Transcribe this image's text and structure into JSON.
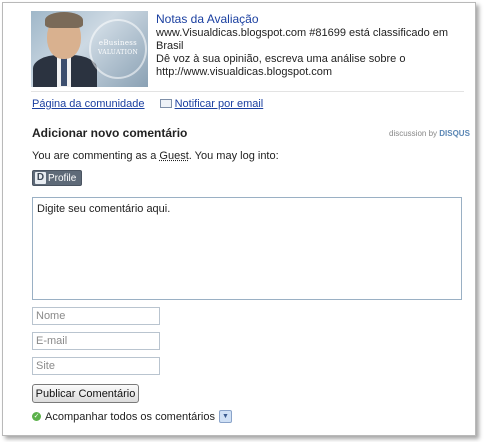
{
  "header": {
    "title": "Notas da Avaliação",
    "seal_text_line1": "eBusiness",
    "seal_text_line2": "Valuation",
    "description_line1": "www.Visualdicas.blogspot.com #81699 está classificado em",
    "description_line2": "Brasil",
    "description_line3": "Dê voz à sua opinião, escreva uma análise sobre o",
    "description_line4": "http://www.visualdicas.blogspot.com"
  },
  "links": {
    "community": "Página da comunidade",
    "notify_email": "Notificar por email"
  },
  "comments": {
    "section_title": "Adicionar novo comentário",
    "powered_prefix": "discussion by ",
    "powered_brand": "DISQUS",
    "commenting_prefix": "You are commenting as a ",
    "commenting_user": "Guest",
    "commenting_suffix": ". You may log into:",
    "profile_label": "Profile",
    "profile_mark": "D",
    "textarea_placeholder": "Digite seu comentário aqui.",
    "name_placeholder": "Nome",
    "email_placeholder": "E-mail",
    "site_placeholder": "Site",
    "publish_label": "Publicar Comentário",
    "follow_label": "Acompanhar todos os comentários"
  },
  "colors": {
    "link": "#1a3fa0",
    "profile_button": "#5e6a78",
    "check_green": "#5bb14a",
    "disqus_blue": "#5a86b4"
  },
  "icons": {
    "mail": "mail-icon",
    "check": "check-circle-icon",
    "dropdown": "chevron-down-icon"
  }
}
